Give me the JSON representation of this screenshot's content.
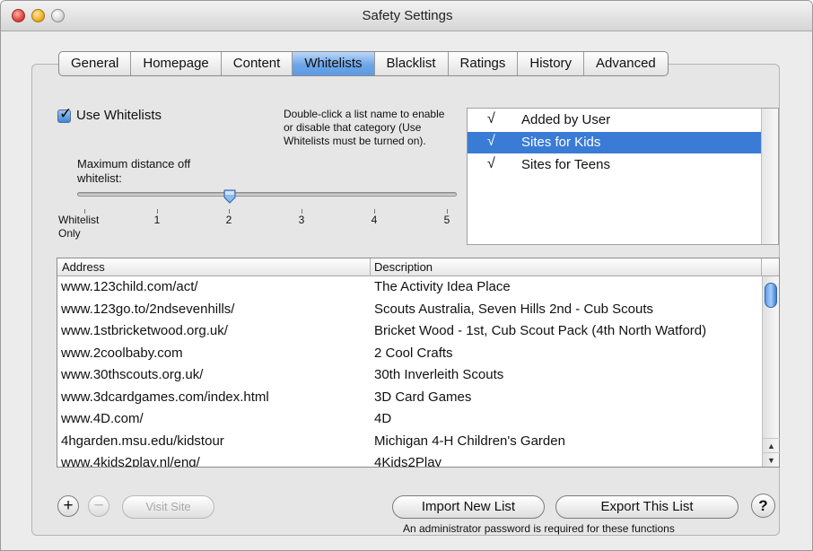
{
  "window": {
    "title": "Safety Settings"
  },
  "tabs": [
    {
      "label": "General"
    },
    {
      "label": "Homepage"
    },
    {
      "label": "Content"
    },
    {
      "label": "Whitelists",
      "active": true
    },
    {
      "label": "Blacklist"
    },
    {
      "label": "Ratings"
    },
    {
      "label": "History"
    },
    {
      "label": "Advanced"
    }
  ],
  "whitelists": {
    "use_label": "Use Whitelists",
    "use_checked": true,
    "help_text": "Double-click a list name to enable or disable that category (Use Whitelists must be turned on).",
    "max_distance_label": "Maximum distance off whitelist:",
    "slider": {
      "value": 2,
      "ticks": [
        "Whitelist Only",
        "1",
        "2",
        "3",
        "4",
        "5"
      ]
    },
    "categories": [
      {
        "check": "√",
        "name": "Added by User",
        "selected": false
      },
      {
        "check": "√",
        "name": "Sites for Kids",
        "selected": true
      },
      {
        "check": "√",
        "name": "Sites for Teens",
        "selected": false
      }
    ]
  },
  "table": {
    "columns": [
      "Address",
      "Description"
    ],
    "rows": [
      {
        "address": "www.123child.com/act/",
        "description": "The Activity Idea Place"
      },
      {
        "address": "www.123go.to/2ndsevenhills/",
        "description": "Scouts Australia, Seven Hills 2nd - Cub Scouts"
      },
      {
        "address": "www.1stbricketwood.org.uk/",
        "description": "Bricket Wood - 1st,  Cub Scout Pack  (4th North Watford)"
      },
      {
        "address": "www.2coolbaby.com",
        "description": "2 Cool Crafts"
      },
      {
        "address": "www.30thscouts.org.uk/",
        "description": "30th Inverleith Scouts"
      },
      {
        "address": "www.3dcardgames.com/index.html",
        "description": "3D Card Games"
      },
      {
        "address": "www.4D.com/",
        "description": "4D"
      },
      {
        "address": "4hgarden.msu.edu/kidstour",
        "description": "Michigan 4-H Children's Garden"
      },
      {
        "address": "www.4kids2play.nl/eng/",
        "description": "4Kids2Play"
      }
    ]
  },
  "footer": {
    "add_symbol": "+",
    "remove_symbol": "−",
    "visit_site": "Visit Site",
    "import_list": "Import New List",
    "export_list": "Export This List",
    "help_symbol": "?",
    "admin_note": "An administrator password is required for these functions"
  }
}
